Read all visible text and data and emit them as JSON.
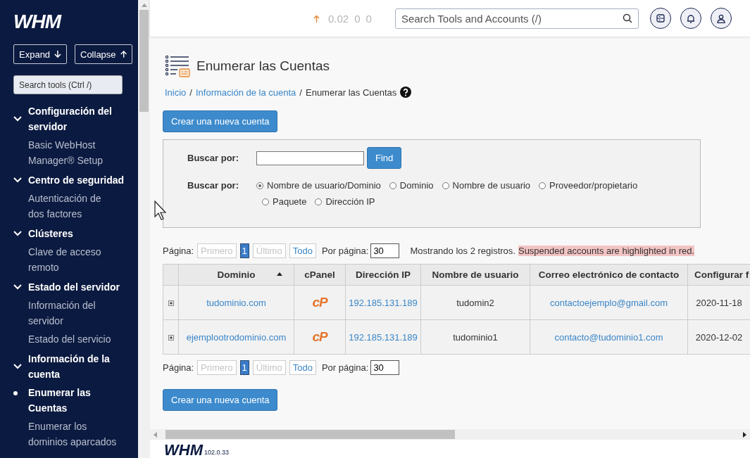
{
  "sidebar": {
    "logo": "WHM",
    "expand_button": "Expand",
    "collapse_button": "Collapse",
    "search": {
      "placeholder": "Search tools (Ctrl /)"
    },
    "sections": [
      {
        "title": "Configuración del servidor",
        "expanded": true,
        "children": [
          {
            "label": "Basic WebHost Manager® Setup",
            "selected": false
          }
        ]
      },
      {
        "title": "Centro de seguridad",
        "expanded": true,
        "children": [
          {
            "label": "Autenticación de dos factores",
            "selected": false
          }
        ]
      },
      {
        "title": "Clústeres",
        "expanded": true,
        "children": [
          {
            "label": "Clave de acceso remoto",
            "selected": false
          }
        ]
      },
      {
        "title": "Estado del servidor",
        "expanded": true,
        "children": [
          {
            "label": "Información del servidor",
            "selected": false
          },
          {
            "label": "Estado del servicio",
            "selected": false
          }
        ]
      },
      {
        "title": "Información de la cuenta",
        "expanded": true,
        "children": [
          {
            "label": "Enumerar las Cuentas",
            "selected": true
          },
          {
            "label": "Enumerar los dominios aparcados",
            "selected": false
          }
        ]
      }
    ]
  },
  "topbar": {
    "load": [
      "0.02",
      "0",
      "0"
    ],
    "search": {
      "placeholder": "Search Tools and Accounts (/)"
    }
  },
  "page": {
    "title": "Enumerar las Cuentas",
    "breadcrumb": [
      {
        "label": "Inicio",
        "link": true,
        "separator": "/"
      },
      {
        "label": "Información de la cuenta",
        "link": true,
        "separator": "/"
      },
      {
        "label": "Enumerar las Cuentas",
        "link": false
      }
    ],
    "create_button": "Crear una nueva cuenta",
    "search_panel": {
      "label": "Buscar por:",
      "find_button": "Find",
      "type_label": "Buscar por:",
      "options": [
        {
          "label": "Nombre de usuario/Dominio",
          "selected": true
        },
        {
          "label": "Dominio",
          "selected": false
        },
        {
          "label": "Nombre de usuario",
          "selected": false
        },
        {
          "label": "Proveedor/propietario",
          "selected": false
        },
        {
          "label": "Paquete",
          "selected": false
        },
        {
          "label": "Dirección IP",
          "selected": false
        }
      ]
    },
    "pagination": {
      "label": "Página:",
      "pages": [
        {
          "label": "Primero",
          "disabled": true,
          "selected": false
        },
        {
          "label": "1",
          "disabled": false,
          "selected": true
        },
        {
          "label": "Último",
          "disabled": true,
          "selected": false
        },
        {
          "label": "Todo",
          "disabled": false,
          "selected": false
        }
      ],
      "per_page_label": "Por página:",
      "per_page": "30"
    },
    "summary": "Mostrando los 2 registros.",
    "notice": "Suspended accounts are highlighted in red.",
    "table": {
      "columns": [
        {
          "label": "Dominio",
          "sorted": true
        },
        {
          "label": "cPanel",
          "sorted": false
        },
        {
          "label": "Dirección IP",
          "sorted": false
        },
        {
          "label": "Nombre de usuario",
          "sorted": false
        },
        {
          "label": "Correo electrónico de contacto",
          "sorted": false
        },
        {
          "label": "Configurar f",
          "sorted": false
        }
      ],
      "rows": [
        {
          "domain": "tudominio.com",
          "cpanel_logo": "cP",
          "ip": "192.185.131.189",
          "username": "tudomin2",
          "email": "contactoejemplo@gmail.com",
          "date": "2020-11-18"
        },
        {
          "domain": "ejemplootrodominio.com",
          "cpanel_logo": "cP",
          "ip": "192.185.131.189",
          "username": "tudominio1",
          "email": "contacto@tudominio1.com",
          "date": "2020-12-02"
        }
      ]
    },
    "bottom_pagination": {
      "label": "Página:",
      "pages": [
        {
          "label": "Primero",
          "disabled": true,
          "selected": false
        },
        {
          "label": "1",
          "disabled": false,
          "selected": true
        },
        {
          "label": "Último",
          "disabled": true,
          "selected": false
        },
        {
          "label": "Todo",
          "disabled": false,
          "selected": false
        }
      ],
      "per_page_label": "Por página:",
      "per_page": "30"
    },
    "bottom_create_button": "Crear una nueva cuenta"
  },
  "footer": {
    "logo": "WHM",
    "version": "102.0.33"
  }
}
